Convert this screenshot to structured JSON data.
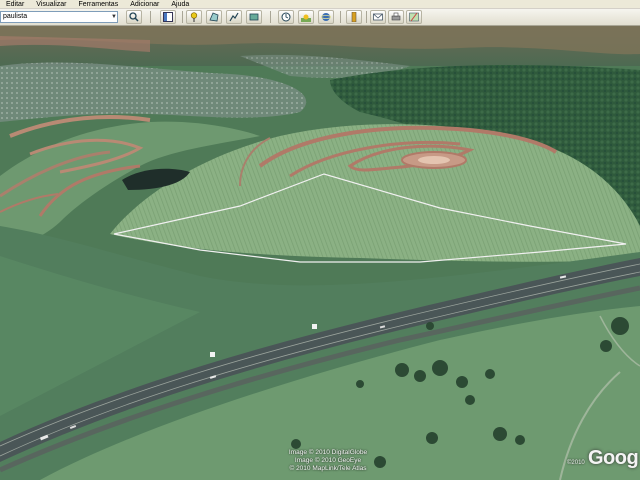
{
  "menu": {
    "items": [
      "Editar",
      "Visualizar",
      "Ferramentas",
      "Adicionar",
      "Ajuda"
    ]
  },
  "toolbar": {
    "search_value": "paulista",
    "dropdown_icon": "chevron-down-icon",
    "buttons": [
      "search-icon",
      "sidebar-icon",
      "placemark-icon",
      "polygon-icon",
      "path-icon",
      "overlay-icon",
      "history-icon",
      "sun-icon",
      "planets-icon",
      "ruler-icon",
      "email-icon",
      "print-icon",
      "maps-icon"
    ]
  },
  "map": {
    "attribution": [
      "Image © 2010 DigitalGlobe",
      "Image © 2010 GeoEye",
      "© 2010 MapLink/Tele Atlas"
    ],
    "logo_year": "©2010",
    "logo": "Goog"
  },
  "colors": {
    "toolbar_bg": "#ece9d8",
    "terrain_green": "#5e8a62",
    "grass_light": "#7ea97a",
    "road": "#4a5657",
    "dirt": "#b07a68"
  }
}
